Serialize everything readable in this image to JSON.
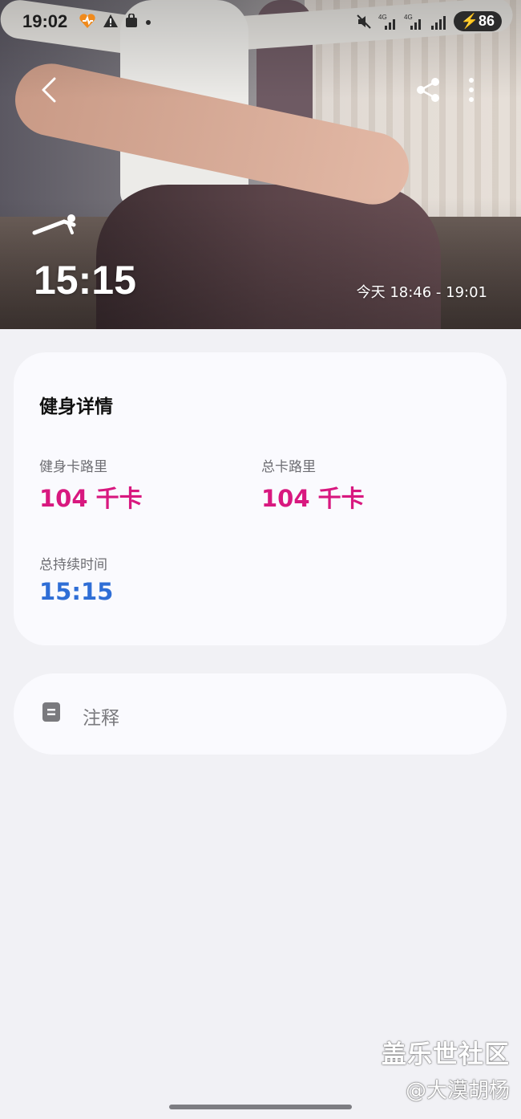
{
  "status_bar": {
    "time": "19:02",
    "battery": "86",
    "network_labels": [
      "4G",
      "4G"
    ]
  },
  "hero": {
    "duration": "15:15",
    "time_range": "今天 18:46 - 19:01",
    "workout_icon": "pushup-workout-icon"
  },
  "details": {
    "title": "健身详情",
    "metrics": [
      {
        "label": "健身卡路里",
        "value": "104 千卡",
        "color": "#d8187f"
      },
      {
        "label": "总卡路里",
        "value": "104 千卡",
        "color": "#d8187f"
      },
      {
        "label": "总持续时间",
        "value": "15:15",
        "color": "#2f6ed6"
      }
    ]
  },
  "notes": {
    "label": "注释",
    "icon": "note-icon"
  },
  "watermark": {
    "line1": "盖乐世社区",
    "line2": "@大漠胡杨"
  },
  "colors": {
    "accent_pink": "#d8187f",
    "accent_blue": "#2f6ed6",
    "background": "#f1f1f5"
  }
}
